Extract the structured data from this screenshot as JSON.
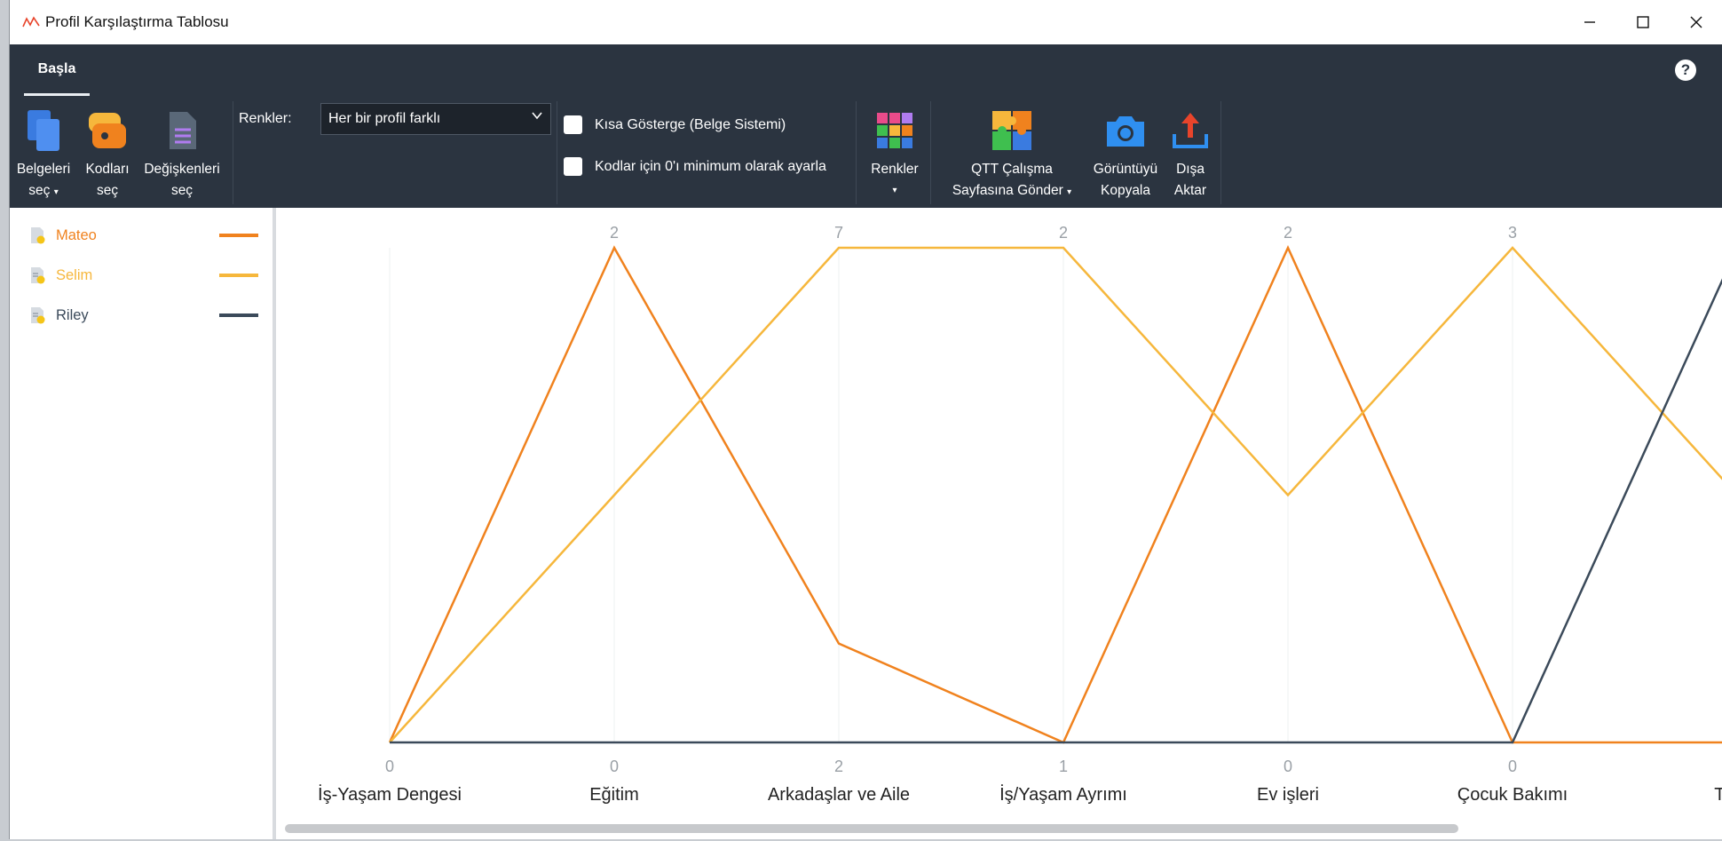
{
  "window": {
    "title": "Profil Karşılaştırma Tablosu"
  },
  "tabs": [
    {
      "label": "Başla"
    }
  ],
  "ribbon": {
    "documents": {
      "line1": "Belgeleri",
      "line2": "seç"
    },
    "codes": {
      "line1": "Kodları",
      "line2": "seç"
    },
    "variables": {
      "line1": "Değişkenleri",
      "line2": "seç"
    },
    "colors_label": "Renkler:",
    "colors_value": "Her bir profil farklı",
    "short_legend": "Kısa Gösterge (Belge Sistemi)",
    "zero_min": "Kodlar için 0'ı minimum olarak ayarla",
    "colors_button": "Renkler",
    "qtt": {
      "line1": "QTT Çalışma",
      "line2": "Sayfasına Gönder"
    },
    "copy_image": {
      "line1": "Görüntüyü",
      "line2": "Kopyala"
    },
    "export": {
      "line1": "Dışa",
      "line2": "Aktar"
    }
  },
  "legend": [
    {
      "name": "Mateo",
      "color": "#f0821e"
    },
    {
      "name": "Selim",
      "color": "#f6b73c"
    },
    {
      "name": "Riley",
      "color": "#3b4a5a"
    }
  ],
  "chart_data": {
    "type": "line",
    "categories": [
      "İş-Yaşam Dengesi",
      "Eğitim",
      "Arkadaşlar ve Aile",
      "İş/Yaşam Ayrımı",
      "Ev işleri",
      "Çocuk Bakımı",
      "Tipik i"
    ],
    "max_labels": [
      "",
      "2",
      "7",
      "2",
      "2",
      "3",
      ""
    ],
    "min_labels": [
      "0",
      "0",
      "2",
      "1",
      "0",
      "0",
      ""
    ],
    "y_range": [
      0,
      1
    ],
    "series": [
      {
        "name": "Mateo",
        "color": "#f0821e",
        "values": [
          0,
          1,
          0.2,
          0,
          1,
          0,
          0
        ]
      },
      {
        "name": "Selim",
        "color": "#f6b73c",
        "values": [
          0,
          0.5,
          1,
          1,
          0.5,
          1,
          0.5
        ]
      },
      {
        "name": "Riley",
        "color": "#3b4a5a",
        "values": [
          0,
          0,
          0,
          0,
          0,
          0,
          1
        ]
      }
    ]
  }
}
